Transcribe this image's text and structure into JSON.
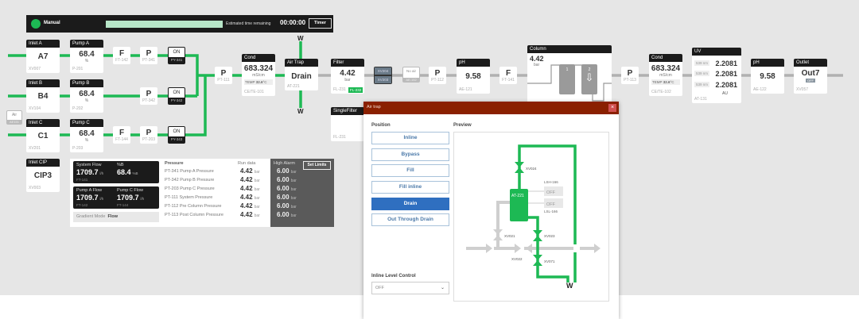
{
  "topbar": {
    "mode": "Manual",
    "mode_color": "#1db954",
    "progress_fraction": 1.0,
    "eta_label": "Estimated time remaining",
    "eta": "00:00:00",
    "timer_button": "Timer"
  },
  "inlets": [
    {
      "title": "Inlet A",
      "value": "A7",
      "tag": "XV007"
    },
    {
      "title": "Inlet B",
      "value": "B4",
      "tag": "XV104"
    },
    {
      "title": "Inlet C",
      "value": "C1",
      "tag": "XV201"
    },
    {
      "title": "Inlet CIP",
      "value": "CIP3",
      "tag": "XV003"
    }
  ],
  "pumps": [
    {
      "title": "Pump A",
      "value": "68.4",
      "unit": "%",
      "tag": "P-201"
    },
    {
      "title": "Pump B",
      "value": "68.4",
      "unit": "%",
      "tag": "P-202"
    },
    {
      "title": "Pump C",
      "value": "68.4",
      "unit": "%",
      "tag": "P-203"
    }
  ],
  "air": {
    "label": "Air",
    "tag": "AE151"
  },
  "sensors": {
    "fa": {
      "label": "F",
      "tag": "FT-142"
    },
    "pa": {
      "label": "P",
      "tag": "PT-341"
    },
    "pb": {
      "label": "P",
      "tag": "PT-342"
    },
    "fc": {
      "label": "F",
      "tag": "FT-144"
    },
    "pc": {
      "label": "P",
      "tag": "PT-203"
    },
    "p111": {
      "label": "P",
      "tag": "PT-111"
    },
    "p112": {
      "label": "P",
      "tag": "PT-112"
    },
    "f141": {
      "label": "F",
      "tag": "FT-141"
    },
    "p113": {
      "label": "P",
      "tag": "PT-113"
    }
  },
  "switches": [
    {
      "state": "ON",
      "tag": "PY-341"
    },
    {
      "state": "ON",
      "tag": "PY-342"
    },
    {
      "state": "ON",
      "tag": "PY-343"
    }
  ],
  "cond1": {
    "title": "Cond",
    "value": "683.324",
    "unit": "mS/cm",
    "temp_label": "TEMP",
    "temp": "32.6",
    "temp_unit": "°C",
    "tag": "CE/TE-101"
  },
  "airtrap": {
    "title": "Air Trap",
    "value": "Drain",
    "tag": "AT-221",
    "w_top": "W",
    "w_bottom": "W"
  },
  "filter": {
    "title": "Filter",
    "value": "4.42",
    "unit": "bar",
    "tag1": "FL-231",
    "tag2": "FL-232"
  },
  "single_filter": {
    "title": "SingleFilter",
    "tag": "FL-231"
  },
  "valves": {
    "v1": "XV204",
    "v2": "XV203"
  },
  "noair": {
    "label": "No air",
    "tag": "AE-152"
  },
  "ph1": {
    "title": "pH",
    "value": "9.58",
    "tag": "AE-121"
  },
  "column": {
    "title": "Column",
    "value": "4.42",
    "unit": "bar",
    "slot1": "1",
    "slot2": "2"
  },
  "cond2": {
    "title": "Cond",
    "value": "683.324",
    "unit": "mS/cm",
    "temp_label": "TEMP",
    "temp": "32.6",
    "temp_unit": "°C",
    "tag": "CE/TE-102"
  },
  "uv": {
    "title": "UV",
    "rows": [
      {
        "nm": "539 nm",
        "value": "2.2081"
      },
      {
        "nm": "539 nm",
        "value": "2.2081"
      },
      {
        "nm": "539 nm",
        "value": "2.2081"
      }
    ],
    "unit": "AU",
    "tag": "AT-131"
  },
  "ph2": {
    "title": "pH",
    "value": "9.58",
    "tag": "AE-122"
  },
  "outlet": {
    "title": "Outlet",
    "value": "Out7",
    "badge": "OFF",
    "tag": "XV057"
  },
  "flows": {
    "system": {
      "label": "System Flow",
      "value": "1709.7",
      "unit": "l/h",
      "tag": "FT-141"
    },
    "pct": {
      "label": "%B",
      "value": "68.4",
      "unit": "%B"
    },
    "pumpa": {
      "label": "Pump A Flow",
      "value": "1709.7",
      "unit": "l/h",
      "tag": "FT-142"
    },
    "pumpc": {
      "label": "Pump C Flow",
      "value": "1709.7",
      "unit": "l/h",
      "tag": "FT-144"
    },
    "gradient_label": "Gradient Mode",
    "gradient_value": "Flow"
  },
  "pressure": {
    "title": "Pressure",
    "run_label": "Run data",
    "rows": [
      {
        "name": "PT-341 Pump A Pressure",
        "value": "4.42",
        "unit": "bar",
        "alarm": "6.00"
      },
      {
        "name": "PT-342 Pump B Pressure",
        "value": "4.42",
        "unit": "bar",
        "alarm": "6.00"
      },
      {
        "name": "PT-203 Pump C Pressure",
        "value": "4.42",
        "unit": "bar",
        "alarm": "6.00"
      },
      {
        "name": "PT-111 System Pressure",
        "value": "4.42",
        "unit": "bar",
        "alarm": "6.00"
      },
      {
        "name": "PT-112 Pre Column Pressure",
        "value": "4.42",
        "unit": "bar",
        "alarm": "6.00"
      },
      {
        "name": "PT-113 Post Column Pressure",
        "value": "4.42",
        "unit": "bar",
        "alarm": "6.00"
      }
    ],
    "alarm_title": "High Alarm",
    "alarm_unit": "bar",
    "set_limits": "Set Limits"
  },
  "dialog": {
    "title": "Air trap",
    "close": "×",
    "position_label": "Position",
    "preview_label": "Preview",
    "buttons": [
      "Inline",
      "Bypass",
      "Fill",
      "Fill inline",
      "Drain",
      "Out Through Drain"
    ],
    "active": "Drain",
    "level_label": "Inline Level Control",
    "level_value": "OFF",
    "preview": {
      "valves": [
        "XV024",
        "XV021",
        "XV023",
        "XV022",
        "XV071"
      ],
      "trap": "AT-221",
      "lsh": "LSH-166",
      "lsl": "LSL-166",
      "lsh_state": "OFF",
      "lsl_state": "OFF",
      "drain": "W"
    }
  },
  "colors": {
    "flow_active": "#1db954",
    "flow_inactive": "#b0b0b0",
    "dialog_header": "#8a2000",
    "active_button": "#2f6fc0"
  }
}
